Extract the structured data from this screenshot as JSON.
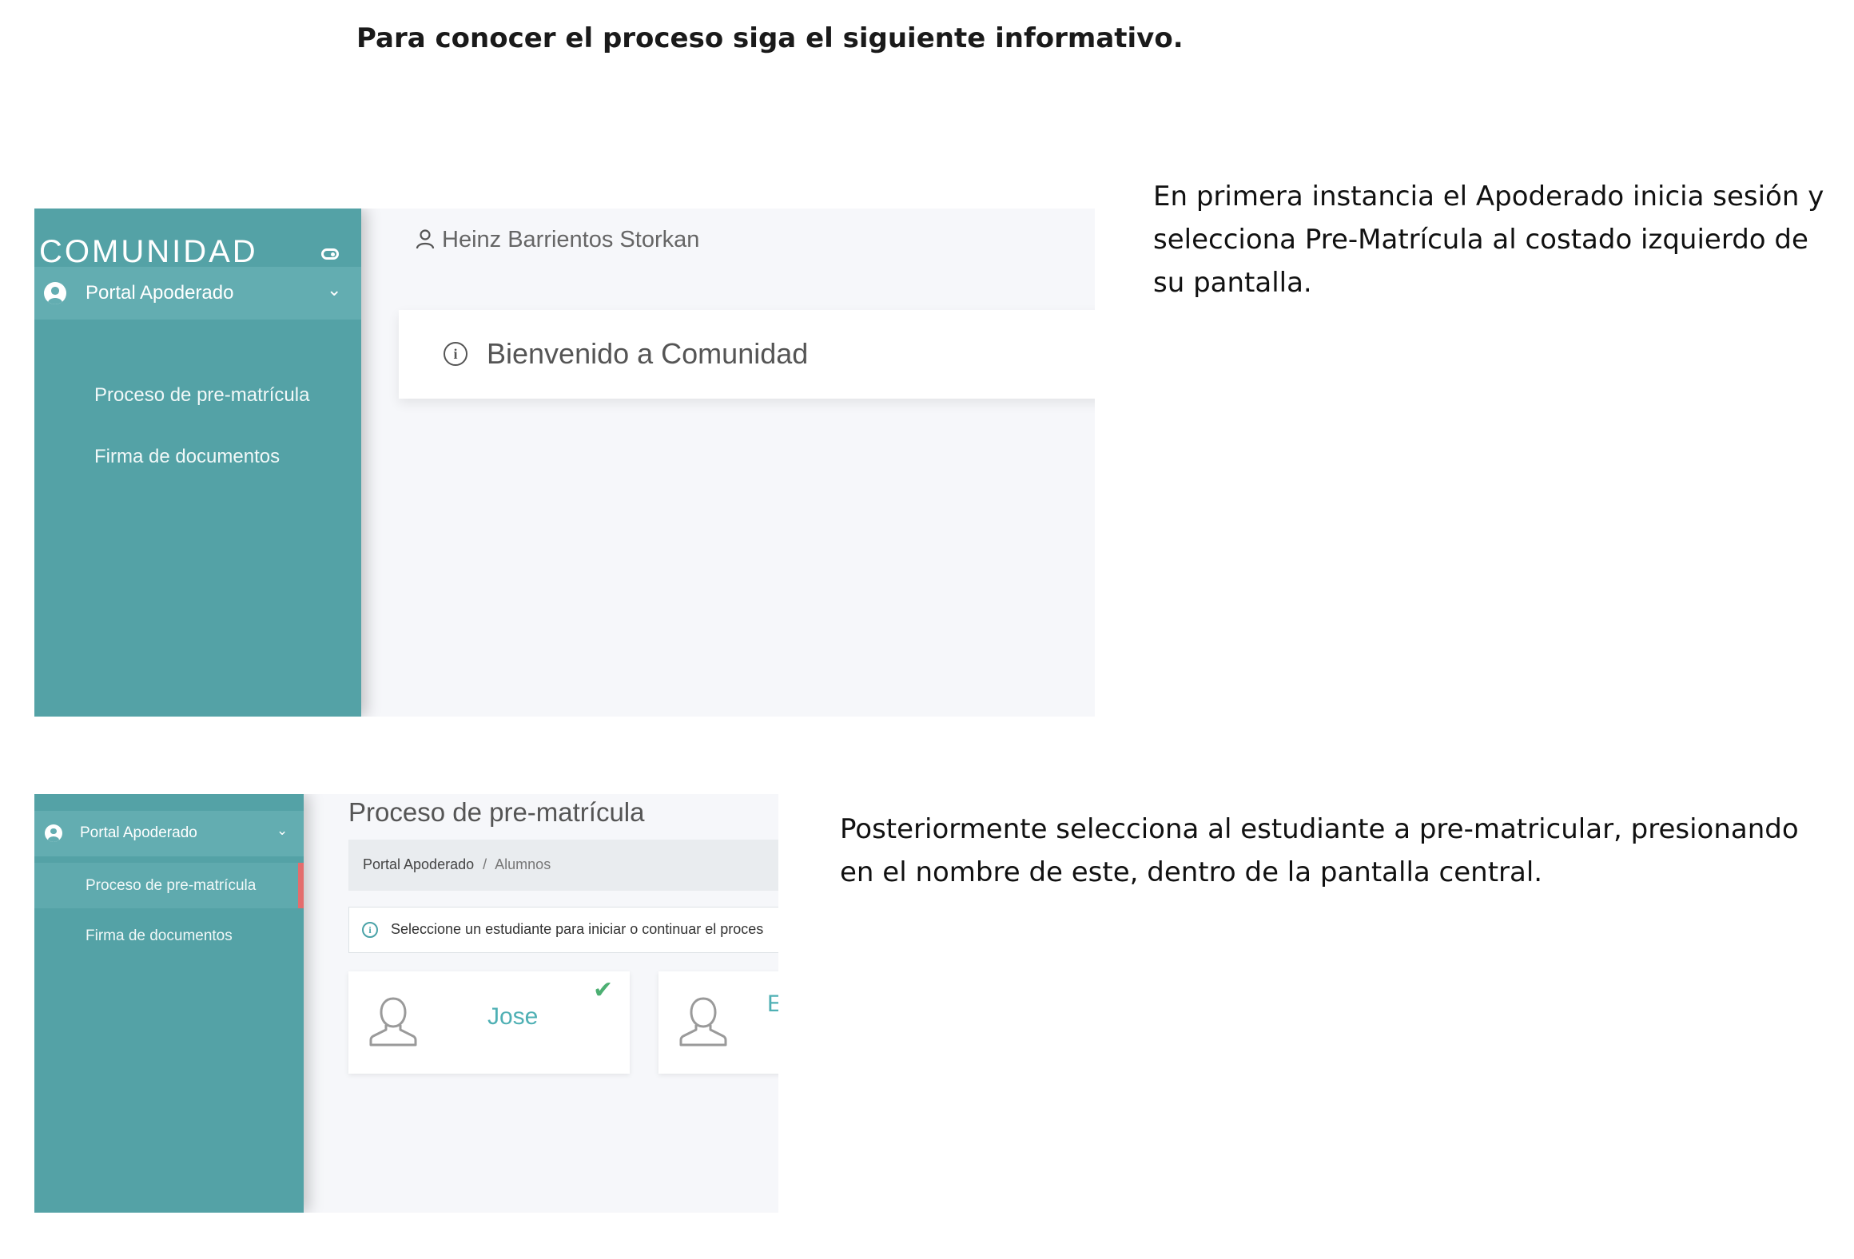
{
  "heading": "Para conocer el proceso siga el siguiente informativo.",
  "step1": {
    "description": "En primera instancia el Apoderado inicia sesión y selecciona Pre-Matrícula al costado izquierdo de su pantalla.",
    "app": {
      "logo": "COMUNIDAD",
      "sidebar": {
        "portal_label": "Portal Apoderado",
        "items": [
          "Proceso de pre-matrícula",
          "Firma de documentos"
        ]
      },
      "user_name": "Heinz Barrientos Storkan",
      "welcome": "Bienvenido a Comunidad"
    }
  },
  "step2": {
    "description": "Posteriormente selecciona al estudiante a pre-matricular, presionando en el nombre de este, dentro de la pantalla central.",
    "app": {
      "sidebar": {
        "portal_label": "Portal Apoderado",
        "items": [
          "Proceso de pre-matrícula",
          "Firma de documentos"
        ]
      },
      "page_title": "Proceso de pre-matrícula",
      "breadcrumb": {
        "root": "Portal Apoderado",
        "separator": "/",
        "current": "Alumnos"
      },
      "alert": "Seleccione un estudiante para iniciar o continuar el proces",
      "students": [
        {
          "name": "Jose",
          "completed": true
        },
        {
          "name": "E",
          "completed": false
        }
      ]
    }
  },
  "colors": {
    "sidebar": "#54a2a6",
    "accent": "#4fb0b4",
    "active_marker": "#e46d6d",
    "check": "#4caf72"
  }
}
